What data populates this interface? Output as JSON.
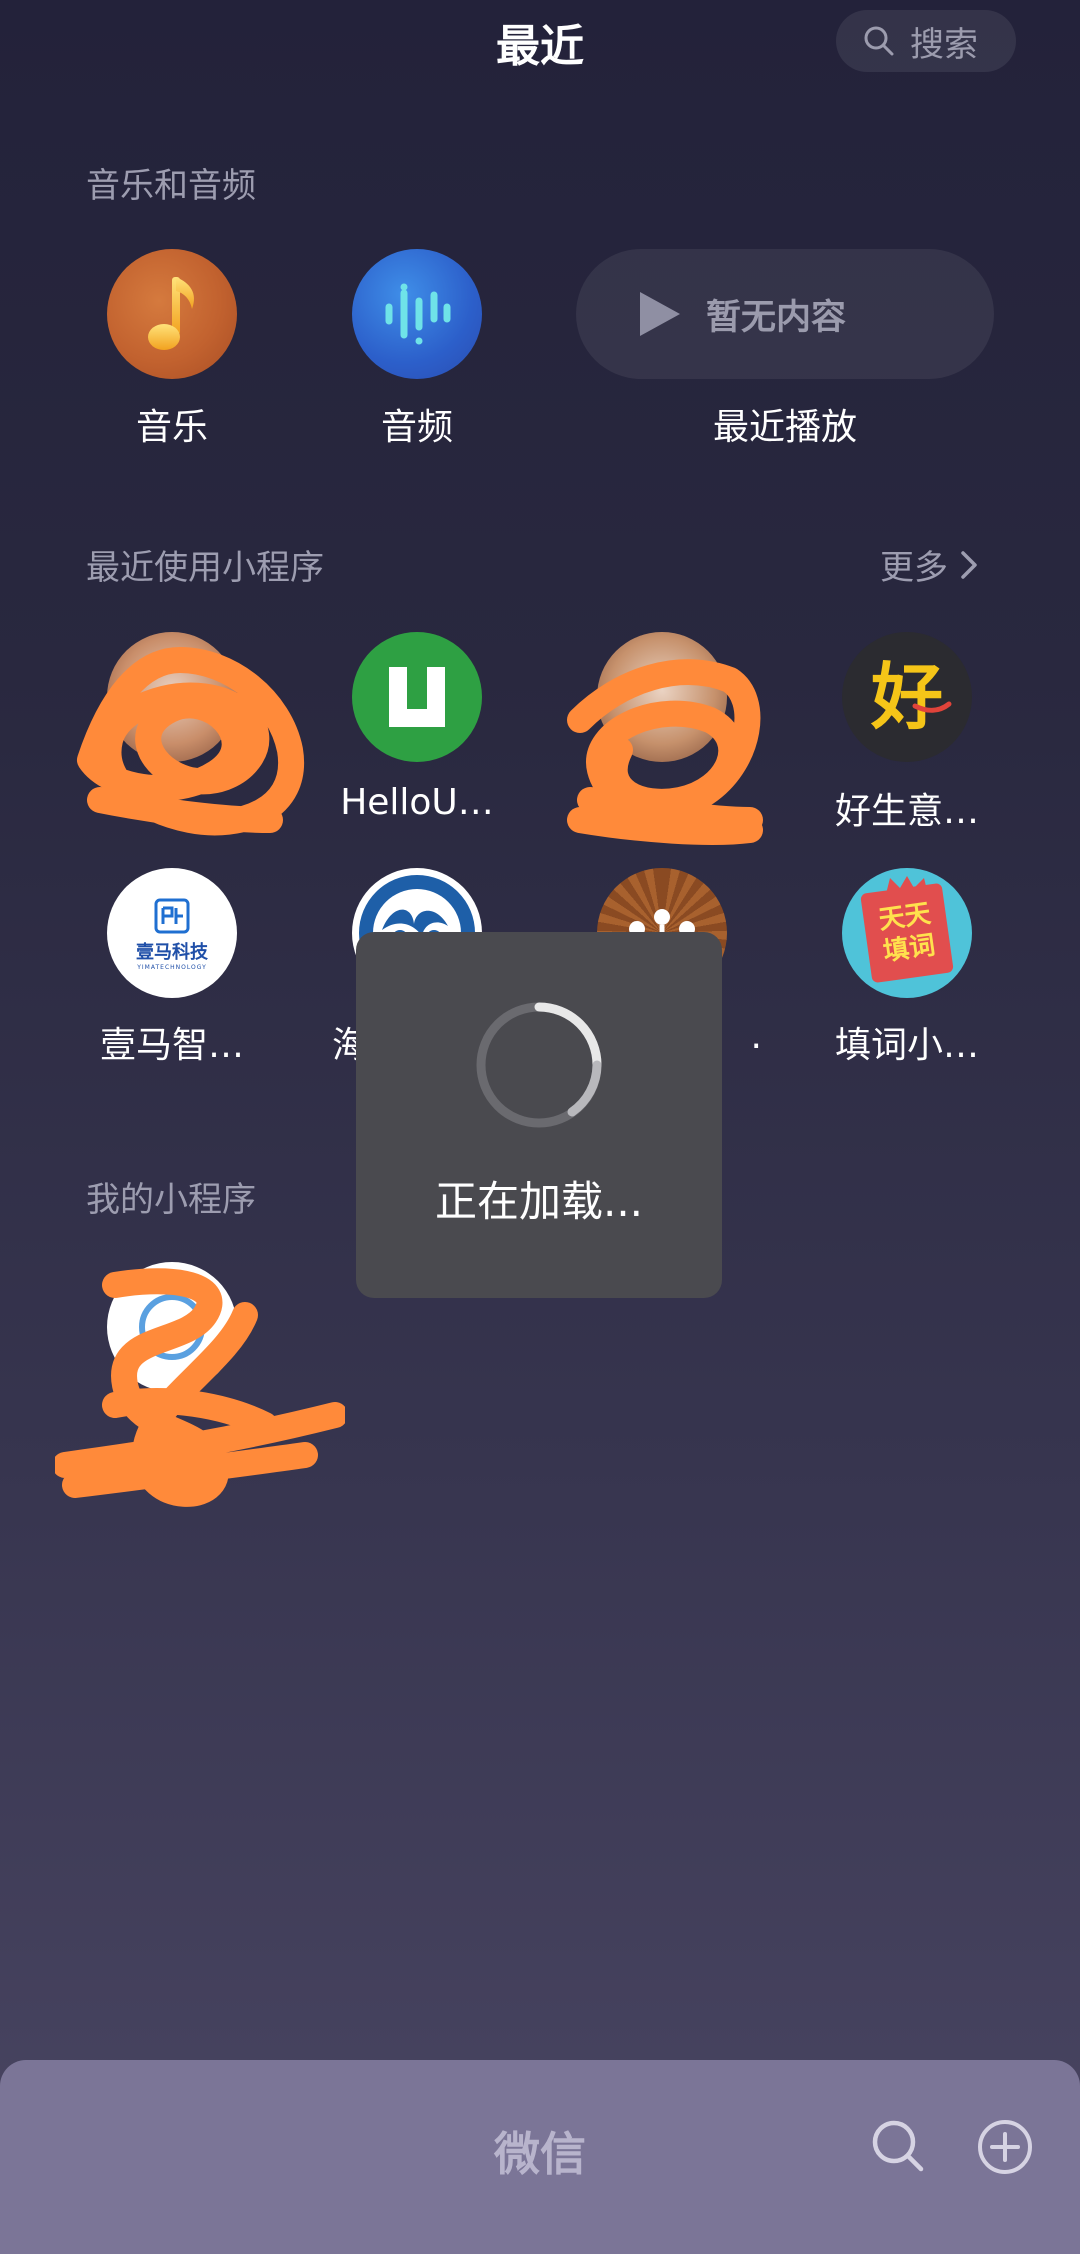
{
  "header": {
    "title": "最近",
    "search_label": "搜索"
  },
  "music_section": {
    "title": "音乐和音频",
    "items": [
      {
        "label": "音乐"
      },
      {
        "label": "音频"
      }
    ],
    "recent_play": {
      "empty_text": "暂无内容",
      "label": "最近播放"
    }
  },
  "recent_mini": {
    "title": "最近使用小程序",
    "more_label": "更多",
    "items": [
      {
        "label": ""
      },
      {
        "label": "HelloU…"
      },
      {
        "label": ""
      },
      {
        "label": "好生意…"
      },
      {
        "label": "壹马智…"
      },
      {
        "label": "海"
      },
      {
        "label": "."
      },
      {
        "label": "填词小…"
      }
    ]
  },
  "my_mini": {
    "title": "我的小程序",
    "items": [
      {
        "label": ""
      }
    ]
  },
  "toast": {
    "text": "正在加载..."
  },
  "bottom_bar": {
    "title": "微信"
  },
  "icons": {
    "yima_text": "壹马科技",
    "yima_sub": "YIMATECHNOLOGY",
    "tiantian_text_1": "天天",
    "tiantian_text_2": "填词"
  },
  "colors": {
    "background_top": "#23223a",
    "background_bottom": "#4a4663",
    "bottom_bar": "#7b7597",
    "scribble": "#ff8a3a",
    "toast_bg": "#4a4a4f"
  }
}
